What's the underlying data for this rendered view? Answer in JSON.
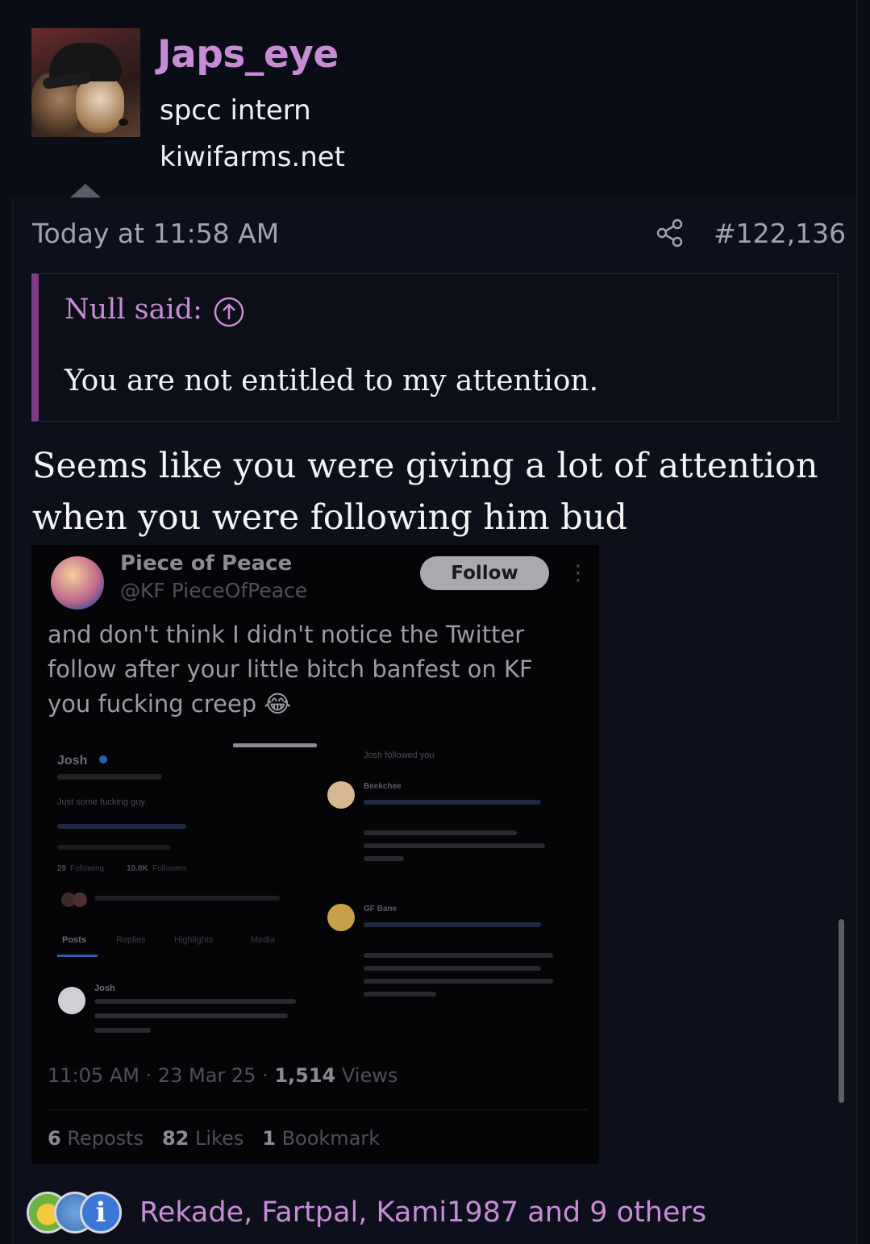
{
  "author": {
    "username": "Japs_eye",
    "title": "spcc intern",
    "site": "kiwifarms.net"
  },
  "post": {
    "timestamp": "Today at 11:58 AM",
    "number": "#122,136",
    "quote": {
      "author": "Null said:",
      "text": "You are not entitled to my attention."
    },
    "body": "Seems like you were giving a lot of attention when you were following him bud"
  },
  "embed": {
    "name": "Piece of Peace",
    "handle": "@KF PieceOfPeace",
    "follow_label": "Follow",
    "more": "⋮",
    "text": "and don't think I didn't notice the Twitter follow after your little bitch banfest on KF you fucking creep 😂",
    "inner": {
      "profile_name": "Josh",
      "bio": "Just some fucking guy.",
      "following_count": "29",
      "following_label": "Following",
      "followers_count": "10.8K",
      "followers_label": "Followers",
      "tabs": [
        "Posts",
        "Replies",
        "Highlights",
        "Media"
      ],
      "pinned_name": "Josh",
      "notice": "Josh followed you",
      "reply1_name": "Beekchee",
      "reply2_name": "GF Bane"
    },
    "time": "11:05 AM",
    "date": "23 Mar 25",
    "views_count": "1,514",
    "views_label": "Views",
    "reposts_count": "6",
    "reposts_label": "Reposts",
    "likes_count": "82",
    "likes_label": "Likes",
    "bookmarks_count": "1",
    "bookmarks_label": "Bookmark"
  },
  "reactions": {
    "icons": [
      "medal-icon",
      "like-icon",
      "info-icon"
    ],
    "info_glyph": "i",
    "users": "Rekade, Fartpal, Kami1987 and 9 others"
  },
  "colors": {
    "accent": "#c88bd6",
    "quote_bar": "#7d3b88",
    "background": "#0d101a"
  }
}
